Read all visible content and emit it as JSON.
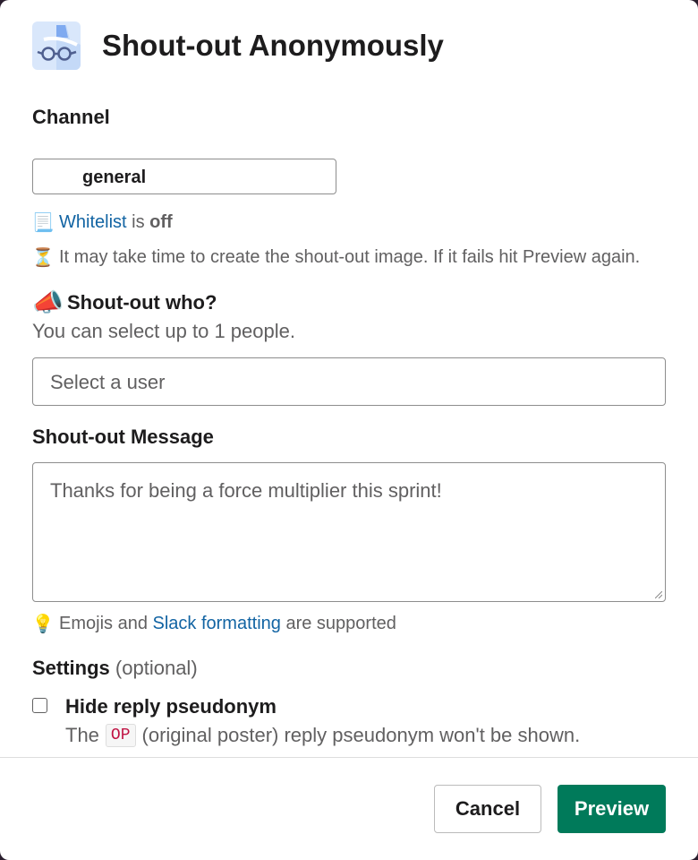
{
  "header": {
    "title": "Shout-out Anonymously",
    "icon": "glasses-hat-icon"
  },
  "channel": {
    "label": "Channel",
    "value": "general"
  },
  "whitelist": {
    "emoji": "📃",
    "link": "Whitelist",
    "middle": " is ",
    "state": "off"
  },
  "timing_note": {
    "emoji": "⏳",
    "text": "It may take time to create the shout-out image. If it fails hit Preview again."
  },
  "who": {
    "emoji": "📣",
    "label": "Shout-out who?",
    "hint": "You can select up to 1 people.",
    "placeholder": "Select a user"
  },
  "message": {
    "label": "Shout-out Message",
    "value": "Thanks for being a force multiplier this sprint!"
  },
  "format_note": {
    "emoji": "💡",
    "pre": "Emojis and ",
    "link": "Slack formatting",
    "post": " are supported"
  },
  "settings": {
    "label": "Settings",
    "optional": "(optional)"
  },
  "hide_reply": {
    "title": "Hide reply pseudonym",
    "desc_pre": "The",
    "code": "OP",
    "desc_post": "(original poster) reply pseudonym won't be shown.",
    "checked": false
  },
  "footer": {
    "cancel": "Cancel",
    "preview": "Preview"
  },
  "colors": {
    "primary": "#007a5a",
    "link": "#1264a3",
    "code": "#c01343"
  }
}
